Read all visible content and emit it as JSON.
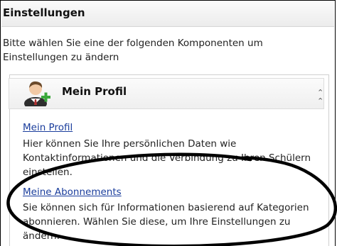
{
  "window": {
    "title": "Einstellungen",
    "intro": "Bitte wählen Sie eine der folgenden Komponenten um Einstellungen zu ändern"
  },
  "panel": {
    "title": "Mein Profil",
    "icon": "user-add-icon",
    "chevron": "collapse-chevron-icon",
    "items": [
      {
        "link": "Mein Profil",
        "description": "Hier können Sie Ihre persönlichen Daten wie Kontaktinformationen und die Verbindung zu Ihren Schülern einstellen."
      },
      {
        "link": "Meine Abonnements",
        "description": "Sie können sich für Informationen basierend auf Kategorien abonnieren. Wählen Sie diese, um Ihre Einstellungen zu ändern."
      }
    ]
  },
  "colors": {
    "link": "#1a3d9c",
    "annotation": "#000000"
  }
}
